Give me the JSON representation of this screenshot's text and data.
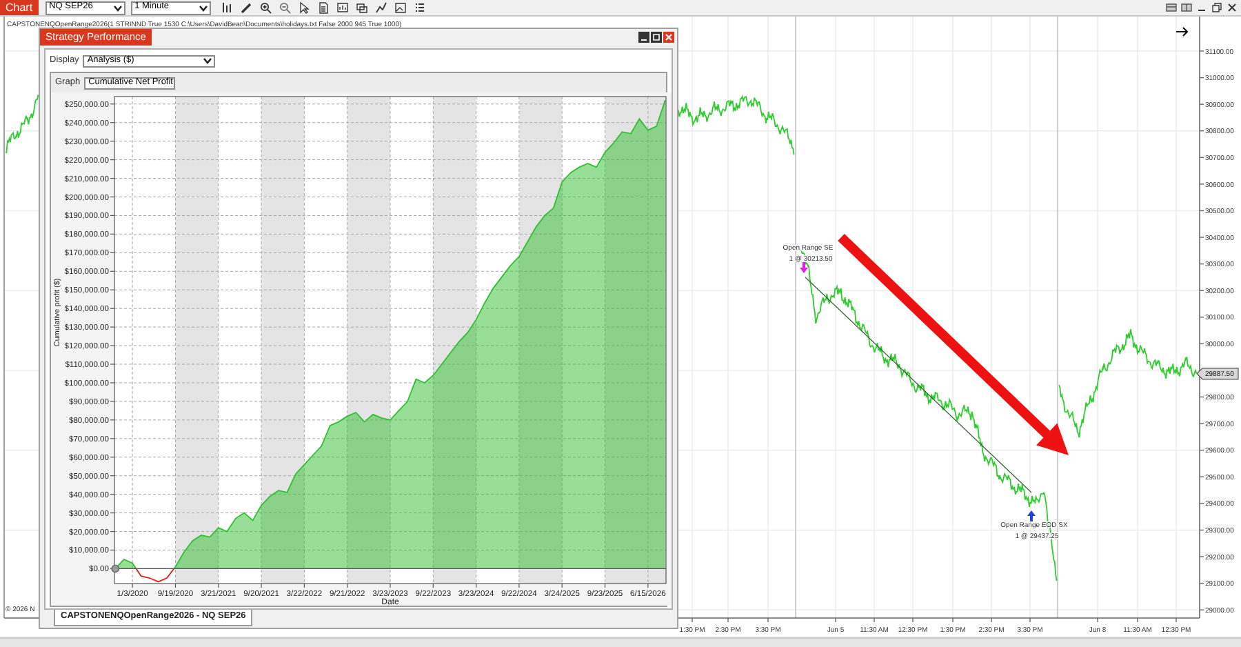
{
  "app_bar": {
    "tab": "Chart",
    "instrument": "NQ SEP26",
    "interval": "1 Minute"
  },
  "chart": {
    "header": "CAPSTONENQOpenRange2026(1 STRINND True 1530 C:\\Users\\DavidBean\\Documents\\holidays.txt False 2000 945 True 1000)",
    "copyright": "© 2026 N",
    "price_labels": [
      "31100.00",
      "31000.00",
      "30900.00",
      "30800.00",
      "30700.00",
      "30600.00",
      "30500.00",
      "30400.00",
      "30300.00",
      "30200.00",
      "30100.00",
      "30000.00",
      "29800.00",
      "29700.00",
      "29600.00",
      "29500.00",
      "29400.00",
      "29300.00",
      "29200.00",
      "29100.00",
      "29000.00"
    ],
    "current_price": "29887.50",
    "time_labels": [
      "1:30 PM",
      "2:30 PM",
      "3:30 PM",
      "Jun 5",
      "11:30 AM",
      "12:30 PM",
      "1:30 PM",
      "2:30 PM",
      "3:30 PM",
      "Jun 8",
      "11:30 AM",
      "12:30 PM"
    ],
    "trades": [
      {
        "kind": "entry",
        "name": "Open Range SE",
        "detail": "1 @ 30213.50"
      },
      {
        "kind": "exit",
        "name": "Open Range EOD SX",
        "detail": "1 @ 29437.25"
      }
    ]
  },
  "strategy_window": {
    "title": "Strategy Performance",
    "display_label": "Display",
    "display_value": "Analysis ($)",
    "graph_label": "Graph",
    "graph_value": "Cumulative Net Profit",
    "chart_data": {
      "type": "area",
      "xlabel": "Date",
      "ylabel": "Cumulative profit ($)",
      "ylim": [
        -8000,
        254000
      ],
      "grid": true,
      "categories": [
        null,
        null,
        "1/3/2020",
        null,
        null,
        null,
        null,
        "9/19/2020",
        null,
        null,
        null,
        null,
        "3/21/2021",
        null,
        null,
        null,
        null,
        "9/20/2021",
        null,
        null,
        null,
        null,
        "3/22/2022",
        null,
        null,
        null,
        null,
        "9/21/2022",
        null,
        null,
        null,
        null,
        "3/23/2023",
        null,
        null,
        null,
        null,
        "9/22/2023",
        null,
        null,
        null,
        null,
        "3/23/2024",
        null,
        null,
        null,
        null,
        "9/22/2024",
        null,
        null,
        null,
        null,
        "3/24/2025",
        null,
        null,
        null,
        null,
        "9/23/2025",
        null,
        null,
        null,
        null,
        "6/15/2026",
        null,
        null
      ],
      "yticks": [
        {
          "value": 250000,
          "label": "$250,000.00"
        },
        {
          "value": 240000,
          "label": "$240,000.00"
        },
        {
          "value": 230000,
          "label": "$230,000.00"
        },
        {
          "value": 220000,
          "label": "$220,000.00"
        },
        {
          "value": 210000,
          "label": "$210,000.00"
        },
        {
          "value": 200000,
          "label": "$200,000.00"
        },
        {
          "value": 190000,
          "label": "$190,000.00"
        },
        {
          "value": 180000,
          "label": "$180,000.00"
        },
        {
          "value": 170000,
          "label": "$170,000.00"
        },
        {
          "value": 160000,
          "label": "$160,000.00"
        },
        {
          "value": 150000,
          "label": "$150,000.00"
        },
        {
          "value": 140000,
          "label": "$140,000.00"
        },
        {
          "value": 130000,
          "label": "$130,000.00"
        },
        {
          "value": 120000,
          "label": "$120,000.00"
        },
        {
          "value": 110000,
          "label": "$110,000.00"
        },
        {
          "value": 100000,
          "label": "$100,000.00"
        },
        {
          "value": 90000,
          "label": "$90,000.00"
        },
        {
          "value": 80000,
          "label": "$80,000.00"
        },
        {
          "value": 70000,
          "label": "$70,000.00"
        },
        {
          "value": 60000,
          "label": "$60,000.00"
        },
        {
          "value": 50000,
          "label": "$50,000.00"
        },
        {
          "value": 40000,
          "label": "$40,000.00"
        },
        {
          "value": 30000,
          "label": "$30,000.00"
        },
        {
          "value": 20000,
          "label": "$20,000.00"
        },
        {
          "value": 10000,
          "label": "$10,000.00"
        },
        {
          "value": 0,
          "label": "$0.00"
        }
      ],
      "series": [
        {
          "color": "#2fbf2f",
          "values": [
            0,
            5000,
            3000,
            -4000,
            -5000,
            -7000,
            -5000,
            1000,
            9000,
            15000,
            18000,
            17000,
            22000,
            20000,
            27000,
            30000,
            26000,
            34000,
            39000,
            42000,
            41000,
            51000,
            56000,
            61000,
            66000,
            77000,
            79000,
            82000,
            84000,
            79000,
            83000,
            81000,
            80000,
            85000,
            90000,
            102000,
            100000,
            104000,
            110000,
            116000,
            122000,
            127000,
            134000,
            143000,
            151000,
            157000,
            163000,
            168000,
            176000,
            184000,
            190000,
            194000,
            208000,
            213000,
            216000,
            218000,
            216000,
            224000,
            229000,
            235000,
            234000,
            242000,
            236000,
            238000,
            252000
          ]
        }
      ]
    },
    "tabs": [
      {
        "label": "CAPSTONENQOpenRange2026 - NQ SEP26",
        "selected": true
      }
    ]
  }
}
